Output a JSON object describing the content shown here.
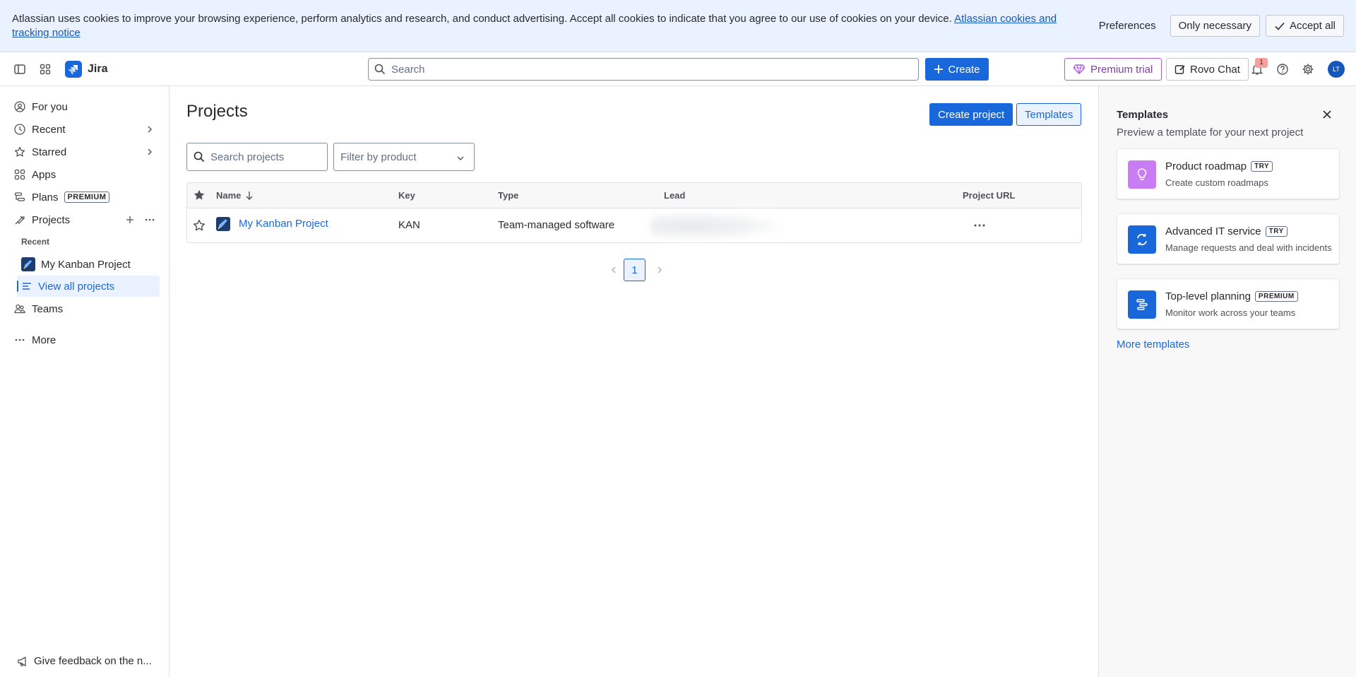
{
  "cookie_banner": {
    "message": "Atlassian uses cookies to improve your browsing experience, perform analytics and research, and conduct advertising. Accept all cookies to indicate that you agree to our use of cookies on your device. ",
    "link_text": "Atlassian cookies and tracking notice",
    "preferences_label": "Preferences",
    "only_necessary_label": "Only necessary",
    "accept_all_label": "Accept all"
  },
  "topnav": {
    "app_name": "Jira",
    "search_placeholder": "Search",
    "create_label": "Create",
    "premium_trial_label": "Premium trial",
    "rovo_chat_label": "Rovo Chat",
    "notification_count": "1",
    "avatar_initials": "LT"
  },
  "sidebar": {
    "items": [
      {
        "label": "For you",
        "icon": "person-circle-icon"
      },
      {
        "label": "Recent",
        "icon": "clock-icon"
      },
      {
        "label": "Starred",
        "icon": "star-icon"
      },
      {
        "label": "Apps",
        "icon": "apps-icon"
      },
      {
        "label": "Plans",
        "icon": "plans-icon",
        "tag": "PREMIUM"
      },
      {
        "label": "Projects",
        "icon": "projects-icon"
      }
    ],
    "recent_section_label": "Recent",
    "recent_project": "My Kanban Project",
    "view_all_label": "View all projects",
    "teams_label": "Teams",
    "more_label": "More",
    "feedback_label": "Give feedback on the n..."
  },
  "main": {
    "title": "Projects",
    "create_project_label": "Create project",
    "templates_label": "Templates",
    "search_placeholder": "Search projects",
    "filter_placeholder": "Filter by product",
    "columns": {
      "name": "Name",
      "key": "Key",
      "type": "Type",
      "lead": "Lead",
      "url": "Project URL"
    },
    "rows": [
      {
        "name": "My Kanban Project",
        "key": "KAN",
        "type": "Team-managed software"
      }
    ],
    "pagination": {
      "current_page": "1"
    }
  },
  "templates_panel": {
    "title": "Templates",
    "subtitle": "Preview a template for your next project",
    "cards": [
      {
        "name": "Product roadmap",
        "tag": "TRY",
        "desc": "Create custom roadmaps",
        "color": "#c97cf4",
        "icon": "lightbulb-icon"
      },
      {
        "name": "Advanced IT service",
        "tag": "TRY",
        "desc": "Manage requests and deal with incidents",
        "color": "#1868db",
        "icon": "refresh-icon"
      },
      {
        "name": "Top-level planning",
        "tag": "PREMIUM",
        "desc": "Monitor work across your teams",
        "color": "#1868db",
        "icon": "timeline-icon"
      }
    ],
    "more_label": "More templates"
  },
  "colors": {
    "brand_blue": "#1868db",
    "banner_bg": "#e9f2fe",
    "premium_purple": "#af59e1"
  }
}
